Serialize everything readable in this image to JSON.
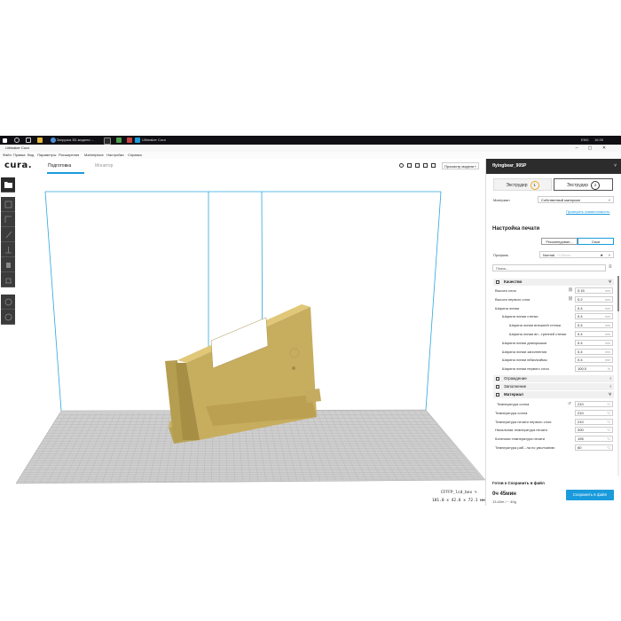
{
  "taskbar": {
    "items": [
      "Загрузка 3D-модели ...",
      "Ultimaker Cura"
    ],
    "lang": "ENG",
    "time": "16:39"
  },
  "window": {
    "title": "Ultimaker Cura",
    "min": "–",
    "max": "▢",
    "close": "✕"
  },
  "menu": [
    "Файл",
    "Правка",
    "Вид",
    "Параметры",
    "Расширения",
    "Marketplace",
    "Настройки",
    "Справка"
  ],
  "header": {
    "logo": "cura.",
    "tab_prepare": "Подготовка",
    "tab_monitor": "Монитор",
    "view_select": "Просмотр модели"
  },
  "object": {
    "name": "CFFFP_lcd_box",
    "dims": "181.0 x 42.6 x 72.1 мм"
  },
  "panel": {
    "printer": "flyingbear_905P",
    "extruder1": "Экструдер",
    "extruder1_num": "1",
    "extruder2": "Экструдер",
    "extruder2_num": "2",
    "material_label": "Материал",
    "material_value": "Собственный материал",
    "compat_link": "Проверить совместимость",
    "print_settings": "Настройка печати",
    "mode_recommended": "Рекомендован...",
    "mode_custom": "Свои",
    "profile_label": "Профиль",
    "profile_value": "Normal",
    "profile_hint": "- 0.15mm",
    "search_placeholder": "Поиск...",
    "cat_quality": "Качество",
    "quality_rows": [
      {
        "label": "Высота слоя",
        "value": "0.15",
        "unit": "mm"
      },
      {
        "label": "Высота первого слоя",
        "value": "0.2",
        "unit": "mm"
      },
      {
        "label": "Ширина линии",
        "value": "0.4",
        "unit": "mm"
      },
      {
        "label": "Ширина линии стенки",
        "value": "0.4",
        "unit": "mm"
      },
      {
        "label": "Ширина линии внешней стенки",
        "value": "0.4",
        "unit": "mm"
      },
      {
        "label": "Ширина линии вн...тренней стенки",
        "value": "0.4",
        "unit": "mm"
      },
      {
        "label": "Ширина линии дна/крышки",
        "value": "0.4",
        "unit": "mm"
      },
      {
        "label": "Ширина линии заполнения",
        "value": "0.4",
        "unit": "mm"
      },
      {
        "label": "Ширина линии юбки/каймы",
        "value": "0.4",
        "unit": "mm"
      },
      {
        "label": "Ширина линии первого слоя",
        "value": "100.0",
        "unit": "%"
      }
    ],
    "cat_walls": "Ограждение",
    "cat_infill": "Заполнение",
    "cat_material": "Материал",
    "material_rows": [
      {
        "label": "Температура сопла",
        "value": "210",
        "unit": "°C"
      },
      {
        "label": "Температура сопла",
        "value": "210",
        "unit": "°C"
      },
      {
        "label": "Температура печати первого слоя",
        "value": "210",
        "unit": "°C"
      },
      {
        "label": "Начальная температура печати",
        "value": "200",
        "unit": "°C"
      },
      {
        "label": "Конечная температура печати",
        "value": "195",
        "unit": "°C"
      },
      {
        "label": "Температура раб...ла по умолчанию",
        "value": "60",
        "unit": "°C"
      }
    ],
    "ready": "Готов к Сохранить в файл",
    "print_time": "0ч 45мин",
    "print_material": "13.42m / ~ 40g",
    "save_button": "Сохранить в файл"
  }
}
